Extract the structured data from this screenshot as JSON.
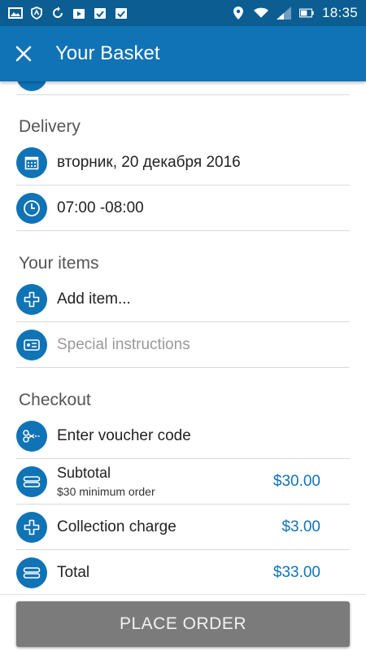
{
  "status_bar": {
    "time": "18:35",
    "left_icons": [
      "photo-icon",
      "shield-icon",
      "sync-icon",
      "play-store-icon",
      "clipboard-check-icon",
      "clipboard-check-icon"
    ],
    "right_icons": [
      "location-icon",
      "wifi-icon",
      "signal-icon",
      "battery-icon"
    ]
  },
  "app_bar": {
    "title": "Your Basket",
    "close_icon": "close-icon"
  },
  "delivery": {
    "section_title": "Delivery",
    "date": "вторник, 20 декабря 2016",
    "time": "07:00 -08:00"
  },
  "items": {
    "section_title": "Your items",
    "add_item": "Add item...",
    "special_instructions_placeholder": "Special instructions"
  },
  "checkout": {
    "section_title": "Checkout",
    "voucher": "Enter voucher code",
    "subtotal_label": "Subtotal",
    "subtotal_note": "$30 minimum order",
    "subtotal_value": "$30.00",
    "collection_label": "Collection charge",
    "collection_value": "$3.00",
    "total_label": "Total",
    "total_value": "$33.00"
  },
  "footer": {
    "place_order": "PLACE ORDER"
  },
  "colors": {
    "status_bar": "#0b5d92",
    "app_bar": "#0f73b6",
    "accent": "#0f73b6",
    "button": "#7b7b7b"
  }
}
